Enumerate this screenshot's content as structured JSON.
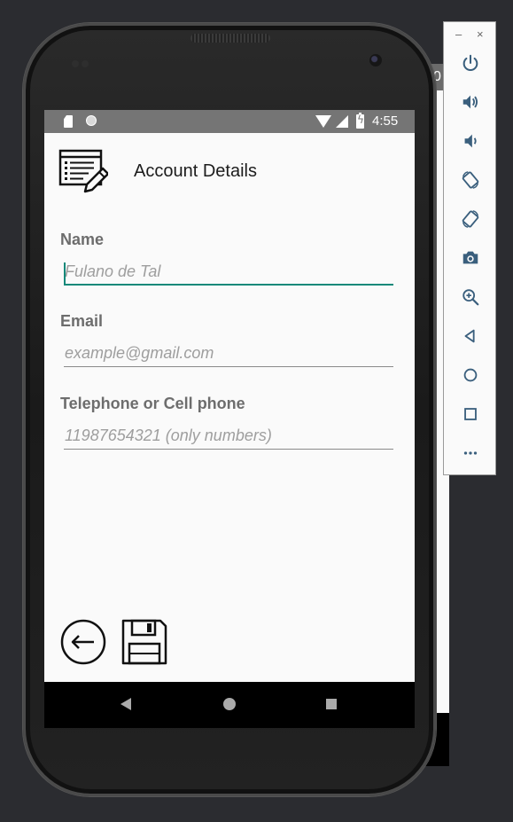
{
  "status_bar": {
    "time": "4:55"
  },
  "background_window": {
    "partial_text": "0"
  },
  "header": {
    "title": "Account Details",
    "icon": "edit-document-icon"
  },
  "form": {
    "name": {
      "label": "Name",
      "placeholder": "Fulano de Tal"
    },
    "email": {
      "label": "Email",
      "placeholder": "example@gmail.com"
    },
    "phone": {
      "label": "Telephone or Cell phone",
      "placeholder": "11987654321 (only numbers)"
    }
  },
  "actions": {
    "back_icon": "arrow-left-circle-icon",
    "save_icon": "floppy-disk-icon"
  },
  "colors": {
    "accent": "#15897a",
    "status_bar": "#757575",
    "label": "#6d6d6d"
  },
  "emulator_toolbar": {
    "window_controls": [
      "–",
      "×"
    ],
    "tools": [
      "power-icon",
      "volume-up-icon",
      "volume-down-icon",
      "rotate-left-icon",
      "rotate-right-icon",
      "camera-icon",
      "zoom-icon",
      "back-icon",
      "home-icon",
      "overview-icon",
      "more-icon"
    ]
  }
}
